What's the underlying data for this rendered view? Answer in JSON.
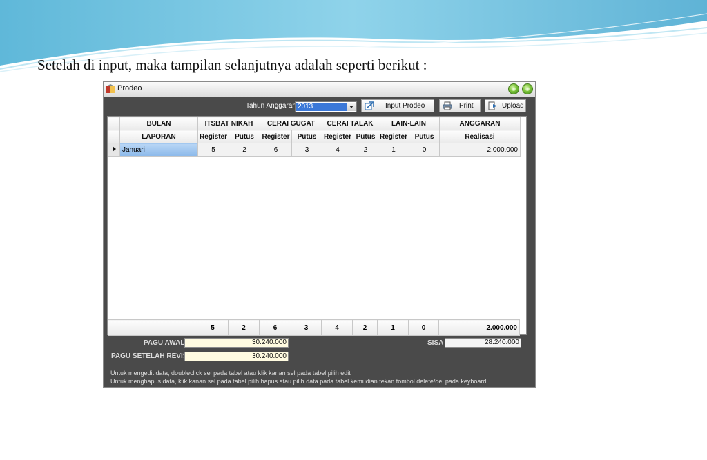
{
  "slide": {
    "text": "Setelah di input, maka tampilan selanjutnya adalah seperti berikut :"
  },
  "window": {
    "title": "Prodeo",
    "app_icon": "prodeo-app-icon",
    "title_buttons": [
      "minimize-icon",
      "close-icon"
    ]
  },
  "toolbar": {
    "tahun_label": "Tahun Anggaran",
    "tahun_value": "2013",
    "input_label": "Input Prodeo",
    "print_label": "Print",
    "upload_label": "Upload"
  },
  "table": {
    "group_headers": [
      "BULAN",
      "ITSBAT NIKAH",
      "CERAI GUGAT",
      "CERAI TALAK",
      "LAIN-LAIN",
      "ANGGARAN"
    ],
    "sub_headers": [
      "LAPORAN",
      "Register",
      "Putus",
      "Register",
      "Putus",
      "Register",
      "Putus",
      "Register",
      "Putus",
      "Realisasi"
    ],
    "rows": [
      {
        "bulan": "Januari",
        "itsbat_register": "5",
        "itsbat_putus": "2",
        "gugat_register": "6",
        "gugat_putus": "3",
        "talak_register": "4",
        "talak_putus": "2",
        "lain_register": "1",
        "lain_putus": "0",
        "realisasi": "2.000.000"
      }
    ],
    "totals": [
      "5",
      "2",
      "6",
      "3",
      "4",
      "2",
      "1",
      "0",
      "2.000.000"
    ]
  },
  "footer": {
    "pagu_awal_label": "PAGU AWAL",
    "pagu_awal_value": "30.240.000",
    "pagu_revisi_label": "PAGU SETELAH REVISI",
    "pagu_revisi_value": "30.240.000",
    "sisa_label": "SISA",
    "sisa_value": "28.240.000",
    "note_edit": "Untuk mengedit data, doubleclick sel pada tabel atau klik kanan sel pada tabel pilih edit",
    "note_delete": "Untuk menghapus data, klik kanan sel pada tabel pilih hapus atau pilih data pada tabel kemudian tekan tombol delete/del pada keyboard"
  },
  "colors": {
    "window_bg": "#4a4a4a",
    "selected_cell": "#8cb9ea",
    "input_field_bg": "#fffbe0"
  }
}
